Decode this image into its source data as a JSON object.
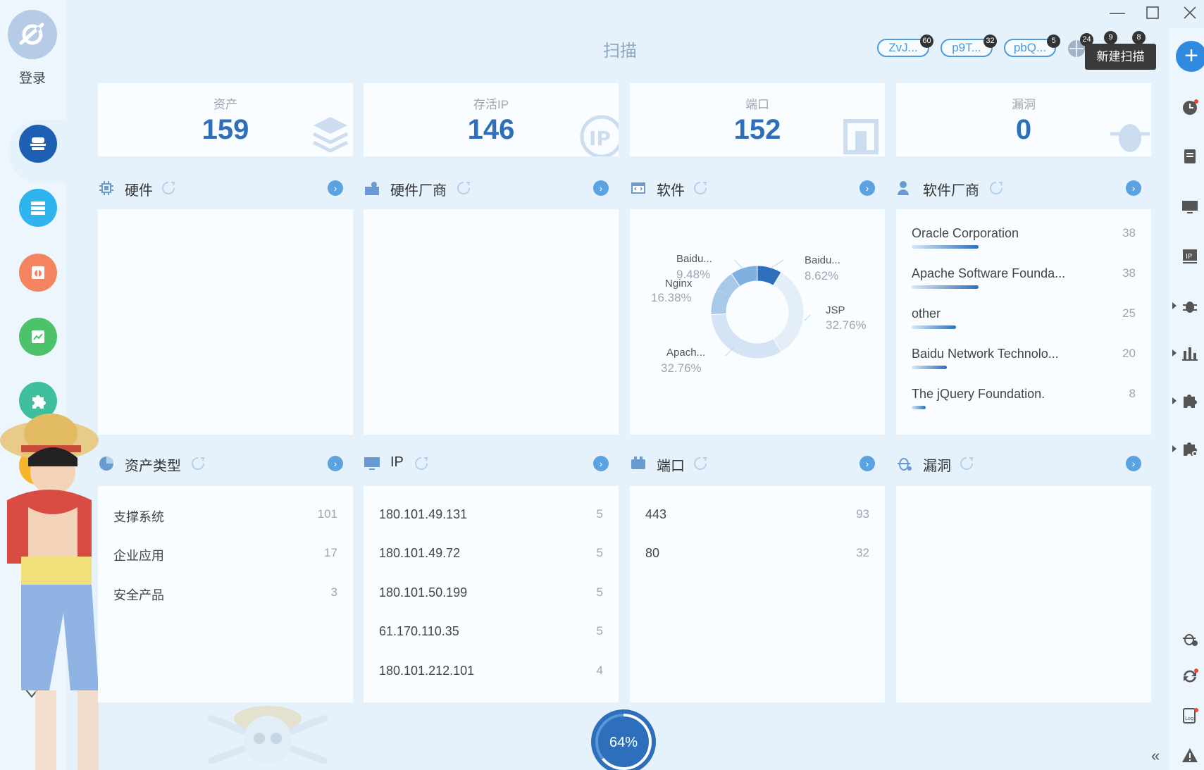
{
  "app": {
    "login_label": "登录",
    "page_title": "扫描",
    "tooltip": "新建扫描",
    "progress": "64%",
    "progress_value": 0.64
  },
  "tasks": [
    {
      "label": "ZvJ...",
      "badge": "60"
    },
    {
      "label": "p9T...",
      "badge": "32"
    },
    {
      "label": "pbQ...",
      "badge": "5"
    }
  ],
  "toolbar_badges": [
    "24",
    "9",
    "8"
  ],
  "stats": [
    {
      "label": "资产",
      "value": "159"
    },
    {
      "label": "存活IP",
      "value": "146"
    },
    {
      "label": "端口",
      "value": "152"
    },
    {
      "label": "漏洞",
      "value": "0"
    }
  ],
  "sections": {
    "hardware": {
      "title": "硬件"
    },
    "hardware_vendor": {
      "title": "硬件厂商"
    },
    "software": {
      "title": "软件"
    },
    "software_vendor": {
      "title": "软件厂商"
    },
    "asset_type": {
      "title": "资产类型"
    },
    "ip": {
      "title": "IP"
    },
    "port": {
      "title": "端口"
    },
    "vuln": {
      "title": "漏洞"
    }
  },
  "chart_data": {
    "type": "pie",
    "categories": [
      "JSP",
      "Apach...",
      "Nginx",
      "Baidu...",
      "Baidu..."
    ],
    "values": [
      32.76,
      32.76,
      16.38,
      9.48,
      8.62
    ],
    "labels": {
      "jsp": {
        "name": "JSP",
        "pct": "32.76%"
      },
      "apache": {
        "name": "Apach...",
        "pct": "32.76%"
      },
      "nginx": {
        "name": "Nginx",
        "pct": "16.38%"
      },
      "baidu1": {
        "name": "Baidu...",
        "pct": "9.48%"
      },
      "baidu2": {
        "name": "Baidu...",
        "pct": "8.62%"
      }
    },
    "colors": [
      "#e3eef9",
      "#d4e4f5",
      "#a9c9ea",
      "#7fb0e0",
      "#2d6fba"
    ]
  },
  "software_vendors": [
    {
      "name": "Oracle Corporation",
      "count": "38",
      "value": 38
    },
    {
      "name": "Apache Software Founda...",
      "count": "38",
      "value": 38
    },
    {
      "name": "other",
      "count": "25",
      "value": 25
    },
    {
      "name": "Baidu Network Technolo...",
      "count": "20",
      "value": 20
    },
    {
      "name": "The jQuery Foundation.",
      "count": "8",
      "value": 8
    }
  ],
  "asset_types": [
    {
      "name": "支撑系统",
      "count": "101"
    },
    {
      "name": "企业应用",
      "count": "17"
    },
    {
      "name": "安全产品",
      "count": "3"
    }
  ],
  "ips": [
    {
      "name": "180.101.49.131",
      "count": "5"
    },
    {
      "name": "180.101.49.72",
      "count": "5"
    },
    {
      "name": "180.101.50.199",
      "count": "5"
    },
    {
      "name": "61.170.110.35",
      "count": "5"
    },
    {
      "name": "180.101.212.101",
      "count": "4"
    }
  ],
  "ports": [
    {
      "name": "443",
      "count": "93"
    },
    {
      "name": "80",
      "count": "32"
    }
  ],
  "colors": {
    "accent": "#2f8ae0",
    "value_text": "#2d6fba",
    "chip_border": "#4f9ad8"
  }
}
